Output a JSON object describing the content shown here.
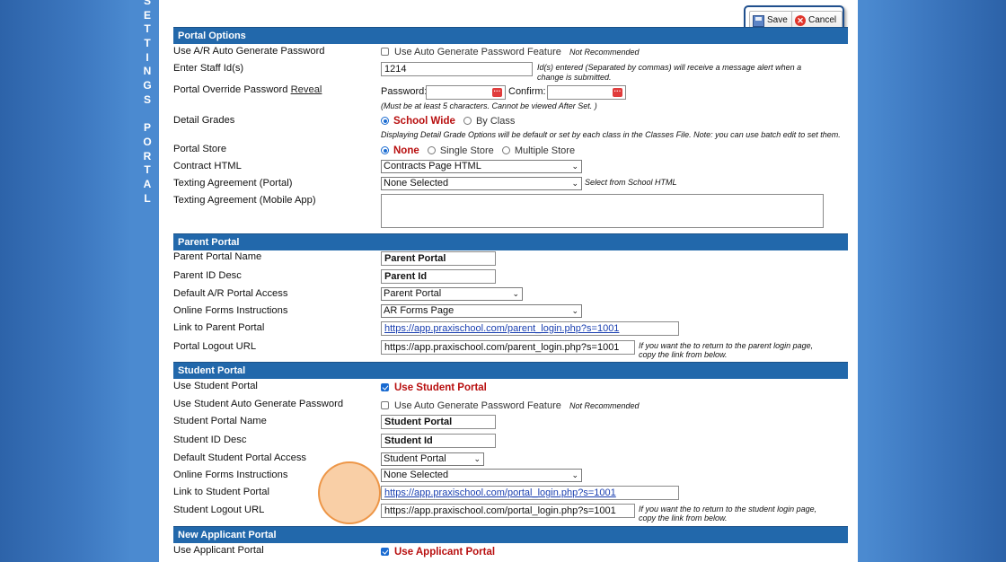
{
  "vertical_title": [
    "S",
    "E",
    "T",
    "T",
    "I",
    "N",
    "G",
    "S",
    " ",
    "P",
    "O",
    "R",
    "T",
    "A",
    "L"
  ],
  "toolbar": {
    "save_label": "Save",
    "cancel_label": "Cancel"
  },
  "portal_options": {
    "header": "Portal Options",
    "auto_pw": {
      "label": "Use A/R Auto Generate Password",
      "checkbox_label": "Use Auto Generate Password Feature",
      "note": "Not Recommended",
      "checked": false
    },
    "staff_ids": {
      "label": "Enter Staff Id(s)",
      "value": "1214",
      "note": "Id(s) entered (Separated by commas) will receive a message alert when a change is submitted."
    },
    "override_pw": {
      "label": "Portal Override Password",
      "reveal": "Reveal",
      "password_label": "Password:",
      "confirm_label": "Confirm:",
      "note": "(Must be at least 5 characters. Cannot be viewed After Set. )"
    },
    "detail_grades": {
      "label": "Detail Grades",
      "opt1": "School Wide",
      "opt2": "By Class",
      "selected": "School Wide",
      "note": "Displaying Detail Grade Options will be default or set by each class in the Classes File. Note: you can use batch edit to set them."
    },
    "portal_store": {
      "label": "Portal Store",
      "opt1": "None",
      "opt2": "Single Store",
      "opt3": "Multiple Store",
      "selected": "None"
    },
    "contract_html": {
      "label": "Contract HTML",
      "value": "Contracts Page HTML"
    },
    "texting_portal": {
      "label": "Texting Agreement (Portal)",
      "value": "None Selected",
      "note": "Select from School HTML"
    },
    "texting_app": {
      "label": "Texting Agreement (Mobile App)",
      "value": ""
    }
  },
  "parent_portal": {
    "header": "Parent Portal",
    "name": {
      "label": "Parent Portal Name",
      "value": "Parent Portal"
    },
    "id_desc": {
      "label": "Parent ID Desc",
      "value": "Parent Id"
    },
    "access": {
      "label": "Default A/R Portal Access",
      "value": "Parent Portal"
    },
    "forms": {
      "label": "Online Forms Instructions",
      "value": "AR Forms Page"
    },
    "link": {
      "label": "Link to Parent Portal",
      "value": "https://app.praxischool.com/parent_login.php?s=1001"
    },
    "logout": {
      "label": "Portal Logout URL",
      "value": "https://app.praxischool.com/parent_login.php?s=1001",
      "note": "If you want the to return to the parent login page, copy the link from below."
    }
  },
  "student_portal": {
    "header": "Student Portal",
    "use": {
      "label": "Use Student Portal",
      "checkbox_label": "Use Student Portal",
      "checked": true
    },
    "auto_pw": {
      "label": "Use Student Auto Generate Password",
      "checkbox_label": "Use Auto Generate Password Feature",
      "note": "Not Recommended",
      "checked": false
    },
    "name": {
      "label": "Student Portal Name",
      "value": "Student Portal"
    },
    "id_desc": {
      "label": "Student ID Desc",
      "value": "Student Id"
    },
    "access": {
      "label": "Default Student Portal Access",
      "value": "Student Portal"
    },
    "forms": {
      "label": "Online Forms Instructions",
      "value": "None Selected"
    },
    "link": {
      "label": "Link to Student Portal",
      "value": "https://app.praxischool.com/portal_login.php?s=1001"
    },
    "logout": {
      "label": "Student Logout URL",
      "value": "https://app.praxischool.com/portal_login.php?s=1001",
      "note": "If you want the to return to the student login page, copy the link from below."
    }
  },
  "applicant_portal": {
    "header": "New Applicant Portal",
    "use": {
      "label": "Use Applicant Portal",
      "checkbox_label": "Use Applicant Portal",
      "checked": true
    }
  },
  "colors": {
    "section_header": "#2268ab",
    "accent_red": "#b80f0f",
    "background": "#4b8ad0",
    "highlight": "#f4a04e"
  }
}
